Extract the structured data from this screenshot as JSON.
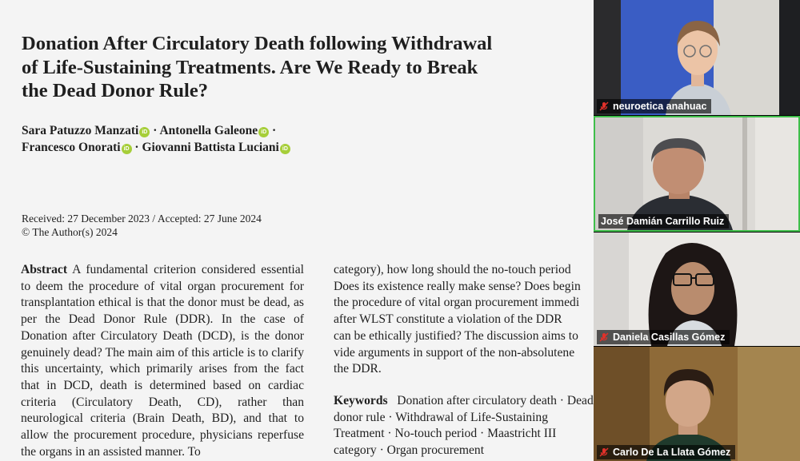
{
  "document": {
    "title_lines": [
      "Donation After Circulatory Death following Withdrawal",
      "of Life-Sustaining Treatments. Are We Ready to Break",
      "the Dead Donor Rule?"
    ],
    "authors": [
      {
        "name": "Sara Patuzzo Manzati"
      },
      {
        "name": "Antonella Galeone"
      },
      {
        "name": "Francesco Onorati"
      },
      {
        "name": "Giovanni Battista Luciani"
      }
    ],
    "received": "Received: 27 December 2023 / Accepted: 27 June 2024",
    "copyright": "© The Author(s) 2024",
    "abstract_heading": "Abstract",
    "abstract_col1": "A fundamental criterion considered essential to deem the procedure of vital organ procurement for transplantation ethical is that the donor must be dead, as per the Dead Donor Rule (DDR). In the case of Donation after Circulatory Death (DCD), is the donor genuinely dead? The main aim of this article is to clarify this uncertainty, which primarily arises from the fact that in DCD, death is determined based on cardiac criteria (Circulatory Death, CD), rather than neurological criteria (Brain Death, BD), and that to allow the procurement procedure, physicians reperfuse the organs in an assisted manner. To",
    "abstract_col2_lines": [
      "category), how long should the no-touch period",
      "Does its existence really make sense? Does begin",
      "the procedure of vital organ procurement immedi",
      "after WLST constitute a violation of the DDR",
      "can be ethically justified? The discussion aims to",
      "vide arguments in support of the non-absolutene",
      "the DDR."
    ],
    "keywords_heading": "Keywords",
    "keywords_text": "Donation after circulatory death · Dead donor rule · Withdrawal of Life-Sustaining Treatment · No-touch period · Maastricht III category · Organ procurement"
  },
  "participants": [
    {
      "name": "neuroetica anahuac",
      "muted": true,
      "active": false,
      "mic_icon": "mic-muted-icon"
    },
    {
      "name": "José Damián Carrillo Ruiz",
      "muted": false,
      "active": true,
      "mic_icon": ""
    },
    {
      "name": "Daniela Casillas Gómez",
      "muted": true,
      "active": false,
      "mic_icon": "mic-muted-icon"
    },
    {
      "name": "Carlo De La Llata Gómez",
      "muted": true,
      "active": false,
      "mic_icon": "mic-muted-icon"
    }
  ],
  "colors": {
    "active_speaker_border": "#3fbf4a",
    "muted_icon": "#e0312a",
    "orcid": "#a6ce39"
  }
}
